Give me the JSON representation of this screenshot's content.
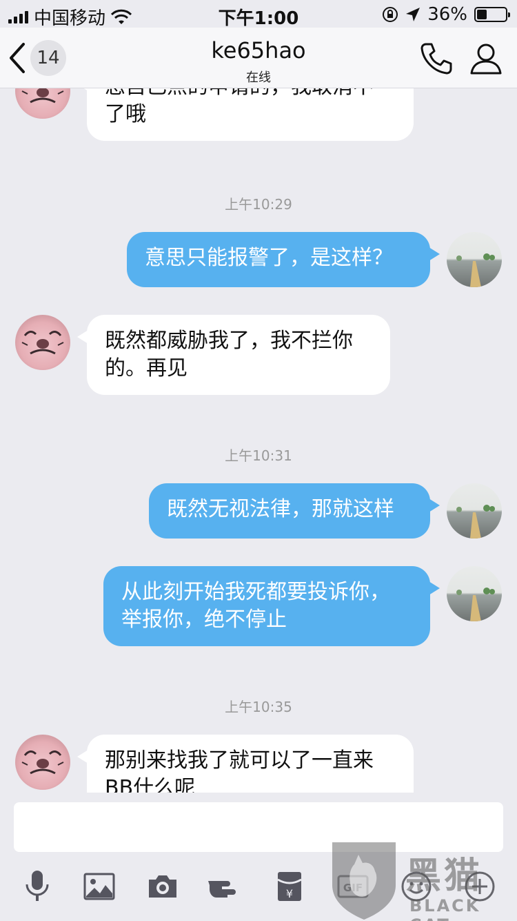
{
  "status_bar": {
    "carrier": "中国移动",
    "time": "下午1:00",
    "battery_percent": "36%",
    "battery_level": 0.36
  },
  "nav": {
    "back_count": "14",
    "title": "ke65hao",
    "subtitle": "在线"
  },
  "messages": [
    {
      "side": "in",
      "text_line1": "您自己点的申请的，我取消不",
      "text_line2": "了哦"
    },
    {
      "type": "time",
      "text": "上午10:29"
    },
    {
      "side": "out",
      "text_line1": "意思只能报警了，是这样？"
    },
    {
      "side": "in",
      "text_line1": "既然都威胁我了，我不拦你",
      "text_line2": "的。再见"
    },
    {
      "type": "time",
      "text": "上午10:31"
    },
    {
      "side": "out",
      "text_line1": "既然无视法律，那就这样"
    },
    {
      "side": "out",
      "text_line1": "从此刻开始我死都要投诉你，",
      "text_line2": "举报你，绝不停止"
    },
    {
      "type": "time",
      "text": "上午10:35"
    },
    {
      "side": "in",
      "text_line1": "那别来找我了就可以了一直来",
      "text_line2": "BB什么呢"
    }
  ],
  "input": {
    "value": "",
    "placeholder": ""
  },
  "toolbar": [
    "microphone-icon",
    "image-icon",
    "camera-icon",
    "poke-icon",
    "red-packet-icon",
    "gif-icon",
    "emoji-icon",
    "plus-icon"
  ],
  "watermark": {
    "cn": "黑猫",
    "en": "BLACK CAT"
  },
  "colors": {
    "outgoing_bubble": "#57b1ef",
    "incoming_bubble": "#ffffff",
    "background": "#ebebf0"
  }
}
